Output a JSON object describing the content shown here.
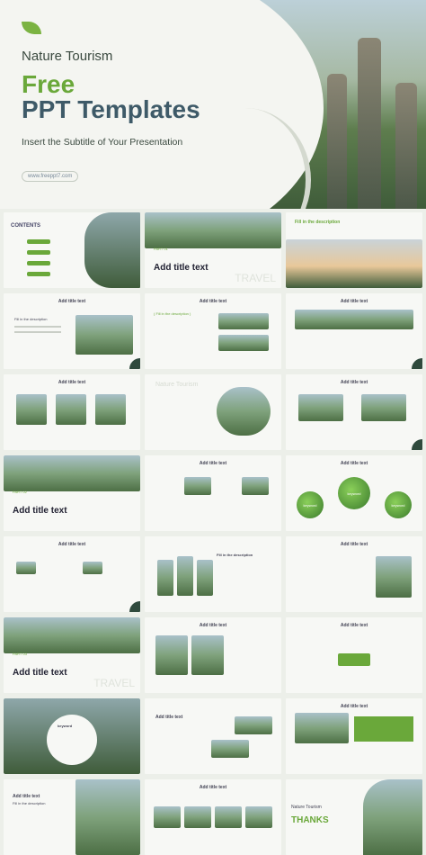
{
  "hero": {
    "title_small": "Nature Tourism",
    "title_free": "Free",
    "title_ppt": "PPT Templates",
    "subtitle": "Insert the Subtitle of Your Presentation",
    "url": "www.freeppt7.com"
  },
  "slides": {
    "contents": "CONTENTS",
    "add_title_text": "Add title text",
    "add_title_big": "Add title text",
    "part_label": "PART 01",
    "part_label2": "PART 02",
    "part_label3": "PART 03",
    "fill_description": "Fill in the description",
    "fill_description_paren": "( Fill in the description )",
    "travel": "TRAVEL",
    "keyword": "keyword",
    "nature_tourism": "Nature Tourism",
    "thanks": "THANKS"
  }
}
